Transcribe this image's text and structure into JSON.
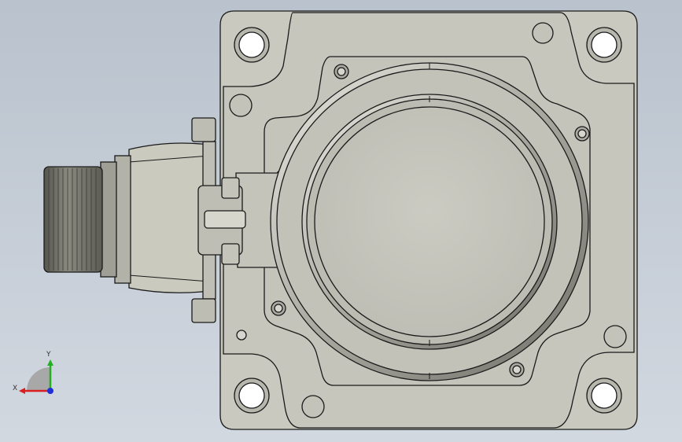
{
  "viewport": {
    "background_top": "#b9c2cd",
    "background_bottom": "#d2d8e0"
  },
  "model": {
    "part_color": "#c8c8bf",
    "part_shade": "#b3b3aa",
    "edge_color": "#1a1a1a"
  },
  "triad": {
    "x_label": "X",
    "y_label": "Y",
    "x_color": "#d91f1f",
    "y_color": "#22b022",
    "z_color": "#1f2fd9"
  }
}
